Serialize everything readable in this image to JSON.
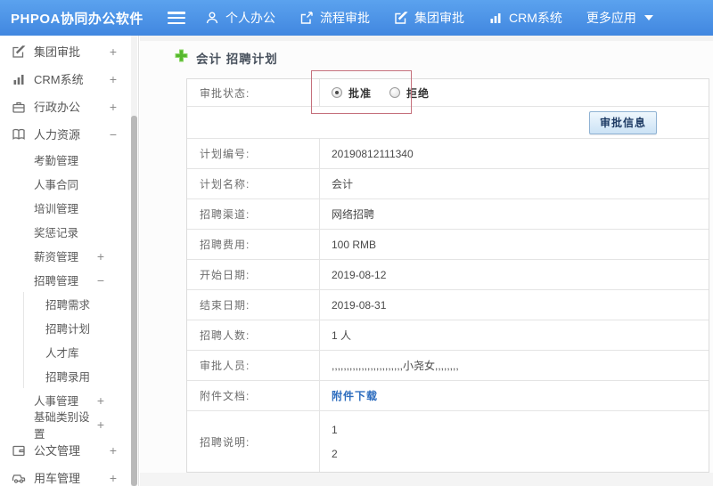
{
  "topnav": {
    "brand": "PHPOA协同办公软件",
    "menu": [
      {
        "label": "个人办公",
        "icon": "user-icon"
      },
      {
        "label": "流程审批",
        "icon": "workflow-icon"
      },
      {
        "label": "集团审批",
        "icon": "edit-icon"
      },
      {
        "label": "CRM系统",
        "icon": "bar-chart-icon"
      },
      {
        "label": "更多应用",
        "icon": "caret-down-icon"
      }
    ]
  },
  "sidebar": {
    "items": [
      {
        "label": "集团审批",
        "toggle": "+"
      },
      {
        "label": "CRM系统",
        "toggle": "+"
      },
      {
        "label": "行政办公",
        "toggle": "+"
      },
      {
        "label": "人力资源",
        "toggle": "−"
      },
      {
        "label": "考勤管理"
      },
      {
        "label": "人事合同"
      },
      {
        "label": "培训管理"
      },
      {
        "label": "奖惩记录"
      },
      {
        "label": "薪资管理",
        "toggle": "+"
      },
      {
        "label": "招聘管理",
        "toggle": "−"
      },
      {
        "label": "招聘需求"
      },
      {
        "label": "招聘计划"
      },
      {
        "label": "人才库"
      },
      {
        "label": "招聘录用"
      },
      {
        "label": "人事管理",
        "toggle": "+"
      },
      {
        "label": "基础类别设置",
        "toggle": "+"
      },
      {
        "label": "公文管理",
        "toggle": "+"
      },
      {
        "label": "用车管理",
        "toggle": "+"
      }
    ]
  },
  "main": {
    "title": "会计 招聘计划",
    "approval_row": {
      "label": "审批状态:",
      "options": [
        {
          "label": "批准",
          "selected": true
        },
        {
          "label": "拒绝",
          "selected": false
        }
      ]
    },
    "approve_info_button": "审批信息",
    "rows": [
      {
        "label": "计划编号:",
        "value": "20190812111340"
      },
      {
        "label": "计划名称:",
        "value": "会计"
      },
      {
        "label": "招聘渠道:",
        "value": "网络招聘"
      },
      {
        "label": "招聘费用:",
        "value": "100 RMB"
      },
      {
        "label": "开始日期:",
        "value": "2019-08-12"
      },
      {
        "label": "结束日期:",
        "value": "2019-08-31"
      },
      {
        "label": "招聘人数:",
        "value": "1 人"
      },
      {
        "label": "审批人员:",
        "value": ",,,,,,,,,,,,,,,,,,,,,,,,小尧女,,,,,,,,"
      },
      {
        "label": "附件文档:",
        "value": "附件下载"
      }
    ],
    "description_row": {
      "label": "招聘说明:",
      "line1": "1",
      "line2": "2"
    }
  },
  "colors": {
    "topnav_blue": "#4a90e2",
    "highlight_red": "#c5707c",
    "link_blue": "#2c6cbe",
    "plus_green": "#56b82e",
    "button_blue": "#cbe2f5"
  }
}
